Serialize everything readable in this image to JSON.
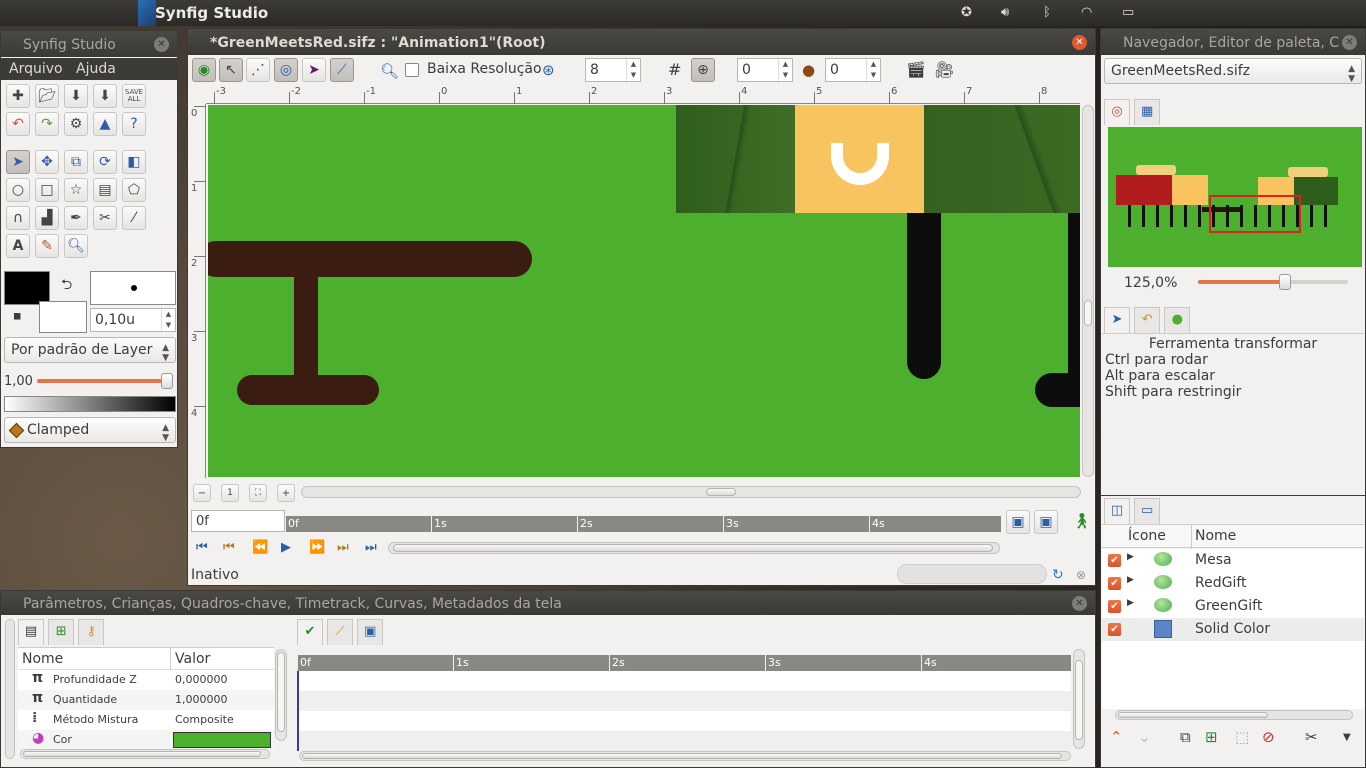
{
  "topbar": {
    "app_title": "Synfig Studio",
    "icons": [
      "accessibility-icon",
      "volume-icon",
      "bluetooth-icon",
      "wifi-icon",
      "battery-icon"
    ]
  },
  "toolbox": {
    "title": "Synfig Studio",
    "menu": [
      "Arquivo",
      "Ajuda"
    ],
    "save_all_label": "SAVE\nALL",
    "brush_size": "0,10u",
    "blend_method": "Por padrão de Layer",
    "opacity_value": "1,00",
    "interpolation": "Clamped"
  },
  "canvas_window": {
    "title": "*GreenMeetsRed.sifz : \"Animation1\"(Root)",
    "low_res_label": "Baixa Resolução",
    "onion_value": "8",
    "past_keyframes": "0",
    "future_keyframes": "0",
    "ruler_h": [
      "-3",
      "-2",
      "-1",
      "0",
      "1",
      "2",
      "3",
      "4",
      "5",
      "6",
      "7",
      "8"
    ],
    "ruler_v": [
      "0",
      "1",
      "2",
      "3",
      "4"
    ],
    "time_field": "0f",
    "timebar_labels": [
      "0f",
      "1s",
      "2s",
      "3s",
      "4s"
    ],
    "status": "Inativo",
    "colors": {
      "background": "#4caf2e",
      "table": "#3a1c10",
      "legs": "#0d0d0d"
    }
  },
  "navigator": {
    "title": "Navegador, Editor de paleta, C",
    "file": "GreenMeetsRed.sifz",
    "zoom": "125,0%",
    "zoom_fraction": 0.58
  },
  "tool_options": {
    "title": "Ferramenta transformar",
    "lines": [
      "Ctrl para rodar",
      "Alt para escalar",
      "Shift para restringir"
    ]
  },
  "layers": {
    "headers": {
      "icon": "Ícone",
      "name": "Nome"
    },
    "rows": [
      {
        "name": "Mesa",
        "icon": "group-icon",
        "color": "#4caf50"
      },
      {
        "name": "RedGift",
        "icon": "group-icon",
        "color": "#4caf50"
      },
      {
        "name": "GreenGift",
        "icon": "group-icon",
        "color": "#4caf50"
      },
      {
        "name": "Solid Color",
        "icon": "solid-color-icon",
        "color": "#5b86c6"
      }
    ]
  },
  "params_panel": {
    "title": "Parâmetros, Crianças, Quadros-chave, Timetrack, Curvas, Metadados da tela",
    "headers": {
      "name": "Nome",
      "value": "Valor"
    },
    "rows": [
      {
        "name": "Profundidade Z",
        "value": "0,000000",
        "icon": "pi-icon"
      },
      {
        "name": "Quantidade",
        "value": "1,000000",
        "icon": "pi-icon"
      },
      {
        "name": "Método Mistura",
        "value": "Composite",
        "icon": "blend-icon"
      },
      {
        "name": "Cor",
        "value": "",
        "icon": "color-icon",
        "swatch": "#4caf2e"
      }
    ],
    "timetrack_labels": [
      "0f",
      "1s",
      "2s",
      "3s",
      "4s"
    ]
  }
}
